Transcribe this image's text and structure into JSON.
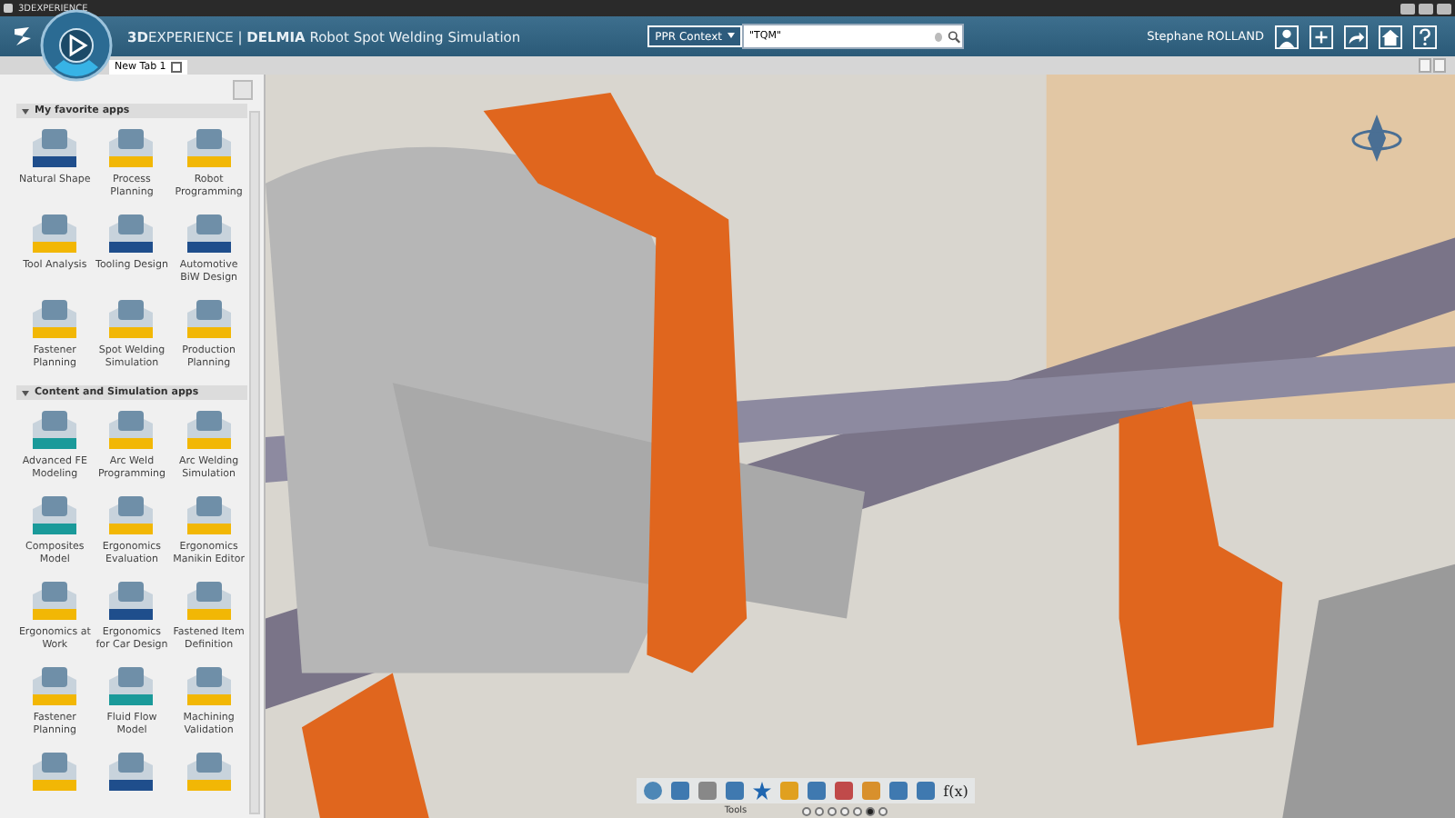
{
  "window": {
    "title": "3DEXPERIENCE"
  },
  "header": {
    "title": "**3D**EXPERIENCE | **DELMIA** Robot Spot Welding Simulation",
    "search_scope": "PPR Context",
    "search_value": "\"TQM\"",
    "user": "Stephane ROLLAND"
  },
  "tabs": [
    {
      "label": "New Tab 1",
      "selected": true
    }
  ],
  "sections": [
    {
      "title": "My favorite apps",
      "expanded": true,
      "apps": [
        {
          "label": "Natural Shape",
          "color": "#1f4e8c"
        },
        {
          "label": "Process Planning",
          "color": "#f2b705"
        },
        {
          "label": "Robot Programming",
          "color": "#f2b705"
        },
        {
          "label": "Tool Analysis",
          "color": "#f2b705"
        },
        {
          "label": "Tooling Design",
          "color": "#1f4e8c"
        },
        {
          "label": "Automotive BiW Design",
          "color": "#1f4e8c"
        },
        {
          "label": "Fastener Planning",
          "color": "#f2b705"
        },
        {
          "label": "Spot Welding Simulation",
          "color": "#f2b705"
        },
        {
          "label": "Production Planning",
          "color": "#f2b705"
        }
      ]
    },
    {
      "title": "Content and Simulation apps",
      "expanded": true,
      "apps": [
        {
          "label": "Advanced FE Modeling",
          "color": "#1a9a9a"
        },
        {
          "label": "Arc Weld Programming",
          "color": "#f2b705"
        },
        {
          "label": "Arc Welding Simulation",
          "color": "#f2b705"
        },
        {
          "label": "Composites Model",
          "color": "#1a9a9a"
        },
        {
          "label": "Ergonomics Evaluation",
          "color": "#f2b705"
        },
        {
          "label": "Ergonomics Manikin Editor",
          "color": "#f2b705"
        },
        {
          "label": "Ergonomics at Work",
          "color": "#f2b705"
        },
        {
          "label": "Ergonomics for Car Design",
          "color": "#1f4e8c"
        },
        {
          "label": "Fastened Item Definition",
          "color": "#f2b705"
        },
        {
          "label": "Fastener Planning",
          "color": "#f2b705"
        },
        {
          "label": "Fluid Flow Model",
          "color": "#1a9a9a"
        },
        {
          "label": "Machining Validation",
          "color": "#f2b705"
        },
        {
          "color": "#f2b705"
        },
        {
          "color": "#1f4e8c"
        },
        {
          "color": "#f2b705"
        }
      ]
    }
  ],
  "toolbar": {
    "label": "Tools",
    "formula": "f(x)",
    "pages": [
      {
        "selected": false
      },
      {
        "selected": false
      },
      {
        "selected": false
      },
      {
        "selected": false
      },
      {
        "selected": false
      },
      {
        "selected": true
      },
      {
        "selected": false
      }
    ]
  }
}
